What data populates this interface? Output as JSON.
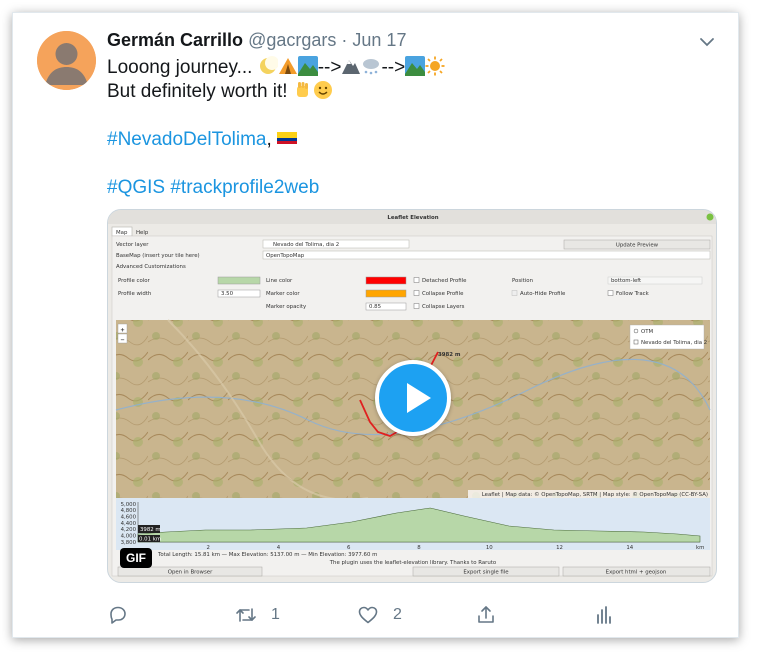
{
  "tweet": {
    "display_name": "Germán Carrillo",
    "handle": "@gacrgars",
    "separator": "·",
    "date": "Jun 17",
    "line1_start": "Looong journey...",
    "arrow1": "-->",
    "arrow2": "-->",
    "line2": "But definitely worth it!",
    "hashtag_tolima": "#NevadoDelTolima",
    "comma": ",",
    "hashtag_qgis": "#QGIS",
    "hashtag_plugin": "#trackprofile2web",
    "retweet_count": "1",
    "like_count": "2"
  },
  "media": {
    "badge": "GIF",
    "window_title": "Leaflet Elevation",
    "tabs": [
      "Map",
      "Help"
    ],
    "vector_layer_label": "Vector layer",
    "vector_layer_value": "Nevado del Tolima, dia 2",
    "update_preview": "Update Preview",
    "basemap_label": "BaseMap (insert your tile here)",
    "basemap_value": "OpenTopoMap",
    "advanced": "Advanced Customizations",
    "profile_color": "Profile color",
    "line_color": "Line color",
    "detached_profile": "Detached Profile",
    "position_label": "Position",
    "position_value": "bottom-left",
    "profile_width": "Profile width",
    "profile_width_value": "3.50",
    "marker_color": "Marker color",
    "collapse_profile": "Collapse Profile",
    "auto_hide": "Auto-Hide Profile",
    "follow_track": "Follow Track",
    "marker_opacity": "Marker opacity",
    "marker_opacity_value": "0.85",
    "collapse_layers": "Collapse Layers",
    "layer_otm": "OTM",
    "layer_track": "Nevado del Tolima, dia 2",
    "summit_label": "3982 m",
    "attribution": "Leaflet | Map data: © OpenTopoMap, SRTM | Map style: © OpenTopoMap (CC-BY-SA)",
    "chart_y_ticks": [
      "5,000",
      "4,800",
      "4,600",
      "4,400",
      "4,200",
      "4,000",
      "3,800"
    ],
    "chart_x_ticks": [
      "2",
      "4",
      "6",
      "8",
      "10",
      "12",
      "14"
    ],
    "chart_x_unit": "km",
    "chart_elev_marker": "3982 m",
    "chart_dist_marker": "0.01 km",
    "stats": "Total Length: 15.81 km — Max Elevation: 5137.00 m — Min Elevation: 3977.60 m",
    "footer_note": "The plugin uses the leaflet-elevation library. Thanks to Raruto",
    "btn_open_browser": "Open in Browser",
    "btn_export_single": "Export single file",
    "btn_export_html": "Export html + geojson",
    "colors": {
      "profile": "#b7d7a8",
      "line": "#ff0000",
      "marker": "#ffa500",
      "play": "#1da1f2"
    }
  }
}
